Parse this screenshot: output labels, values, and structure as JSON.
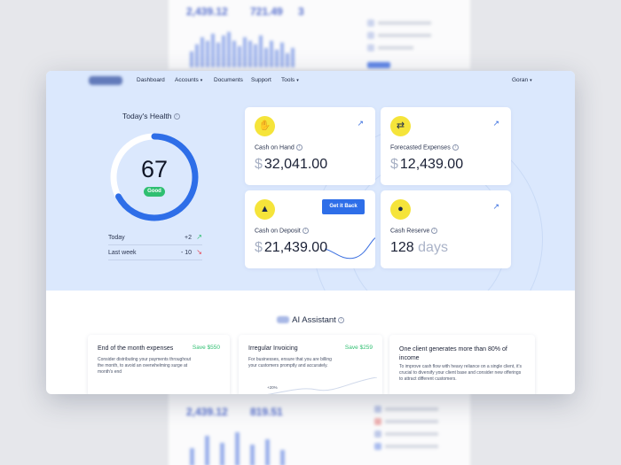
{
  "nav": {
    "items": [
      {
        "label": "Dashboard",
        "caret": false
      },
      {
        "label": "Accounts",
        "caret": true
      },
      {
        "label": "Documents",
        "caret": false
      },
      {
        "label": "Support",
        "caret": false
      },
      {
        "label": "Tools",
        "caret": true
      }
    ],
    "user": "Goran"
  },
  "health": {
    "title": "Today's Health",
    "score": "67",
    "score_fraction": 0.67,
    "badge": "Good",
    "rows": [
      {
        "label": "Today",
        "value": "+2",
        "trend": "up"
      },
      {
        "label": "Last week",
        "value": "- 10",
        "trend": "down"
      }
    ]
  },
  "cards": {
    "cash_on_hand": {
      "label": "Cash on Hand",
      "currency": "$",
      "amount": "32,041.00",
      "icon": "hand-money-icon",
      "link_icon": "arrow-up-right-icon"
    },
    "forecasted_expenses": {
      "label": "Forecasted Expenses",
      "currency": "$",
      "amount": "12,439.00",
      "icon": "exchange-money-icon",
      "link_icon": "arrow-up-right-icon"
    },
    "cash_on_deposit": {
      "label": "Cash on Deposit",
      "currency": "$",
      "amount": "21,439.00",
      "icon": "deposit-coins-icon",
      "button": "Get it Back"
    },
    "cash_reserve": {
      "label": "Cash Reserve",
      "amount": "128",
      "unit": "days",
      "icon": "piggy-bank-icon",
      "link_icon": "arrow-up-right-icon"
    }
  },
  "ai_assistant": {
    "title": "AI Assistant",
    "tips": [
      {
        "title": "End of the month expenses",
        "save": "Save $550",
        "body": "Consider distributing your payments throughout the month, to avoid an overwhelming surge at month's end"
      },
      {
        "title": "Irregular Invoicing",
        "save": "Save $259",
        "body": "For businesses, ensure that you are billing your customers promptly and accurately.",
        "mini_label": "+20%"
      },
      {
        "title": "One client generates more than 80% of income",
        "save": "",
        "body": "To improve cash flow with heavy reliance on a single client, it's crucial to diversify your client base and consider new offerings to attract different customers."
      }
    ]
  },
  "background": {
    "top_stats": [
      "2,439.12",
      "721.49",
      "3"
    ],
    "bottom_stats": [
      "2,439.12",
      "819.51"
    ]
  },
  "colors": {
    "accent": "#2e6ee8",
    "hero_bg": "#dbe8fd",
    "good": "#2fbf71",
    "icon_bg": "#f5e43a",
    "trend_up": "#2fbf71",
    "trend_down": "#e64b5a"
  }
}
